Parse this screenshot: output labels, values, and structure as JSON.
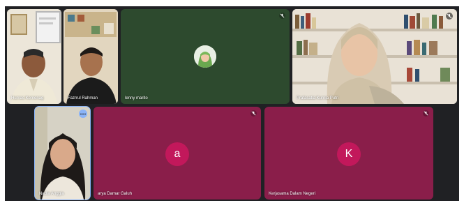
{
  "participants": [
    {
      "name": "Humas Kemenag",
      "kind": "video"
    },
    {
      "name": "Fazrrul Rahman",
      "kind": "video"
    },
    {
      "name": "lenny marito",
      "kind": "photo-avatar"
    },
    {
      "name": "Prafasatia Kurnia Putri",
      "kind": "video"
    },
    {
      "name": "Nadia Anggia",
      "kind": "video",
      "pinned_menu": true
    },
    {
      "name": "arya Damar Galuh",
      "kind": "letter-avatar",
      "letter": "a"
    },
    {
      "name": "Kerjasama Dalam Negeri",
      "kind": "letter-avatar",
      "letter": "K"
    }
  ],
  "colors": {
    "grid_background": "#202124",
    "green_tile": "#2d4a2e",
    "magenta_tile": "#8a1e4a",
    "avatar_circle": "#c2185b",
    "accent_blue": "#8ab4f8"
  },
  "icons": {
    "mic": "mic-muted-icon",
    "more": "more-options-icon"
  }
}
